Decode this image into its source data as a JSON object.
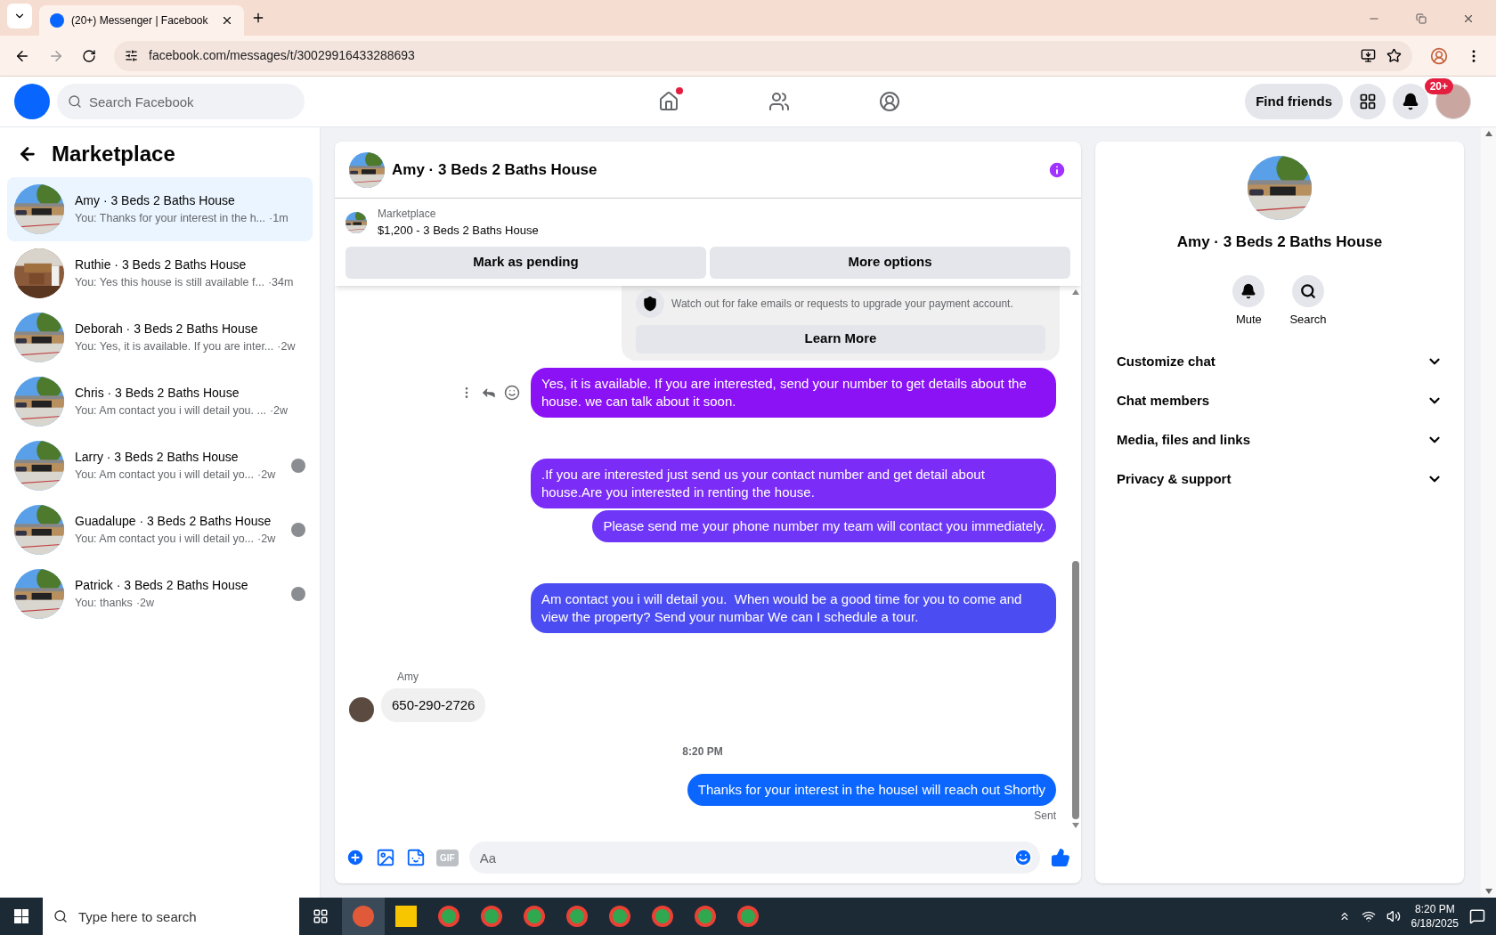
{
  "browser": {
    "tab_title": "(20+) Messenger | Facebook",
    "url": "facebook.com/messages/t/30029916433288693"
  },
  "topbar": {
    "search_placeholder": "Search Facebook",
    "home_alert": true,
    "find_friends": "Find friends",
    "notification_badge": "20+"
  },
  "sidebar": {
    "title": "Marketplace",
    "threads": [
      {
        "name": "Amy · 3 Beds 2 Baths House",
        "preview": "You: Thanks for your interest in the h...",
        "time": "·1m",
        "selected": true,
        "seen": false
      },
      {
        "name": "Ruthie · 3 Beds 2 Baths House",
        "preview": "You: Yes this house is still available f...",
        "time": "·34m",
        "selected": false,
        "seen": false
      },
      {
        "name": "Deborah · 3 Beds 2 Baths House",
        "preview": "You: Yes, it is available. If you are inter...",
        "time": "·2w",
        "selected": false,
        "seen": false
      },
      {
        "name": "Chris · 3 Beds 2 Baths House",
        "preview": "You: Am contact you i will detail you. ...",
        "time": "·2w",
        "selected": false,
        "seen": false
      },
      {
        "name": "Larry · 3 Beds 2 Baths House",
        "preview": "You: Am contact you i will detail yo...",
        "time": "·2w",
        "selected": false,
        "seen": true
      },
      {
        "name": "Guadalupe · 3 Beds 2 Baths House",
        "preview": "You: Am contact you i will detail yo...",
        "time": "·2w",
        "selected": false,
        "seen": true
      },
      {
        "name": "Patrick · 3 Beds 2 Baths House",
        "preview": "You: thanks",
        "time": "·2w",
        "selected": false,
        "seen": true
      }
    ]
  },
  "chat": {
    "title": "Amy · 3 Beds 2 Baths House",
    "listing": {
      "label": "Marketplace",
      "title": "$1,200 - 3 Beds 2 Baths House",
      "buttons": [
        "Mark as pending",
        "More options"
      ]
    },
    "notice": {
      "text": "Watch out for fake emails or requests to upgrade your payment account.",
      "button": "Learn More"
    },
    "groups": [
      {
        "kind": "outgoing",
        "actions": true,
        "messages": [
          "Yes, it is available. If you are interested, send your number to get details about the house. we can talk about it soon."
        ]
      },
      {
        "kind": "outgoing",
        "actions": false,
        "messages": [
          ".If you are interested just send us your contact number and get detail about house.Are you interested in renting the house.",
          "Please send me your phone number my team will contact you immediately."
        ]
      },
      {
        "kind": "outgoing",
        "actions": false,
        "messages": [
          "Am contact you i will detail you.  When would be a good time for you to come and view the property? Send your numbar We can I schedule a tour."
        ]
      },
      {
        "kind": "incoming",
        "sender": "Amy",
        "messages": [
          "650-290-2726"
        ]
      },
      {
        "kind": "timestamp",
        "text": "8:20 PM"
      },
      {
        "kind": "outgoing",
        "actions": false,
        "status": "Sent",
        "messages": [
          "Thanks for your interest in the houseI will reach out Shortly"
        ]
      }
    ],
    "composer": {
      "gif_label": "GIF",
      "placeholder": "Aa"
    }
  },
  "info_panel": {
    "title": "Amy · 3 Beds 2 Baths House",
    "actions": [
      {
        "kind": "mute",
        "label": "Mute"
      },
      {
        "kind": "search",
        "label": "Search"
      }
    ],
    "sections": [
      {
        "label": "Customize chat",
        "expanded": false
      },
      {
        "label": "Chat members",
        "expanded": false
      },
      {
        "label": "Media, files and links",
        "expanded": false
      },
      {
        "label": "Privacy & support",
        "expanded": false
      }
    ]
  },
  "taskbar": {
    "search_placeholder": "Type here to search",
    "time": "8:20 PM",
    "date": "6/18/2025"
  }
}
